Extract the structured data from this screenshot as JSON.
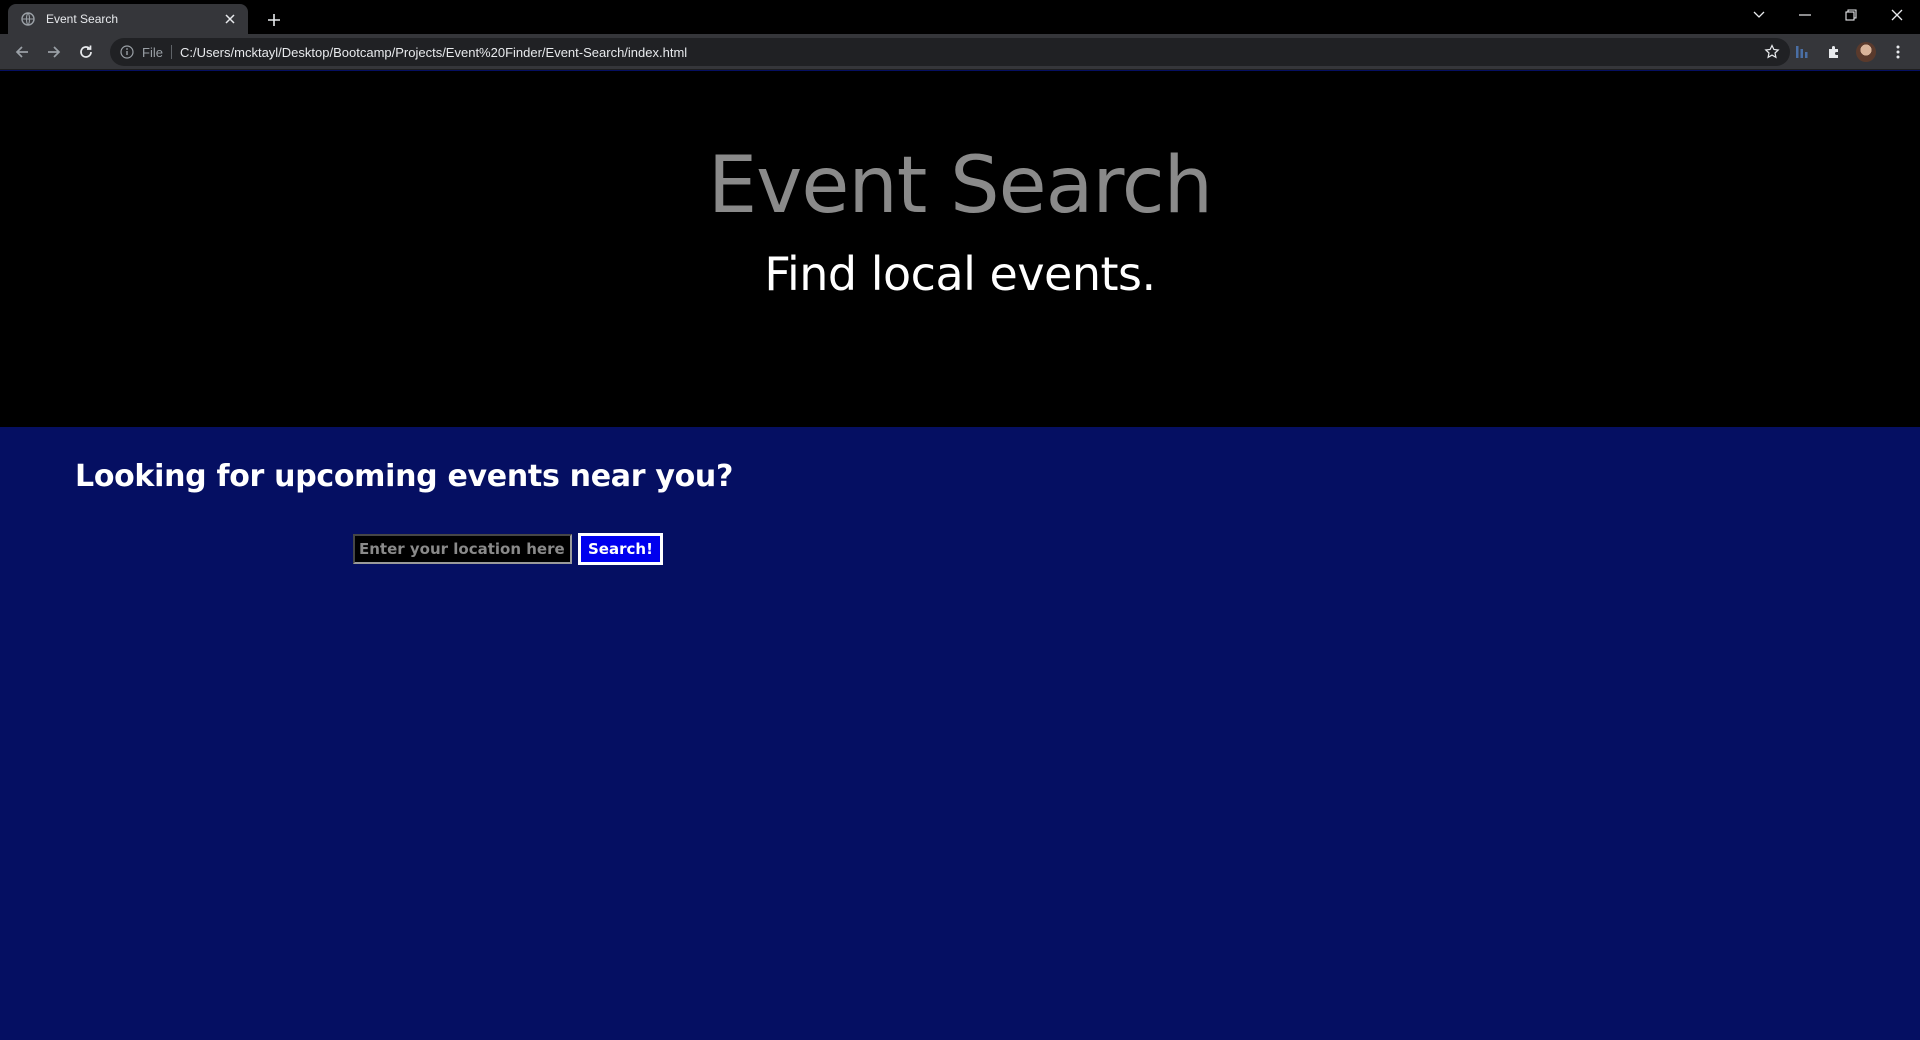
{
  "browser": {
    "tab_title": "Event Search",
    "omnibox_scheme": "File",
    "url": "C:/Users/mcktayl/Desktop/Bootcamp/Projects/Event%20Finder/Event-Search/index.html"
  },
  "hero": {
    "title": "Event Search",
    "subtitle": "Find local events."
  },
  "main": {
    "heading": "Looking for upcoming events near you?",
    "search_placeholder": "Enter your location here.",
    "search_value": "",
    "search_button": "Search!"
  },
  "colors": {
    "hero_bg": "#000000",
    "main_bg": "#050f62",
    "button_bg": "#0000ee"
  }
}
